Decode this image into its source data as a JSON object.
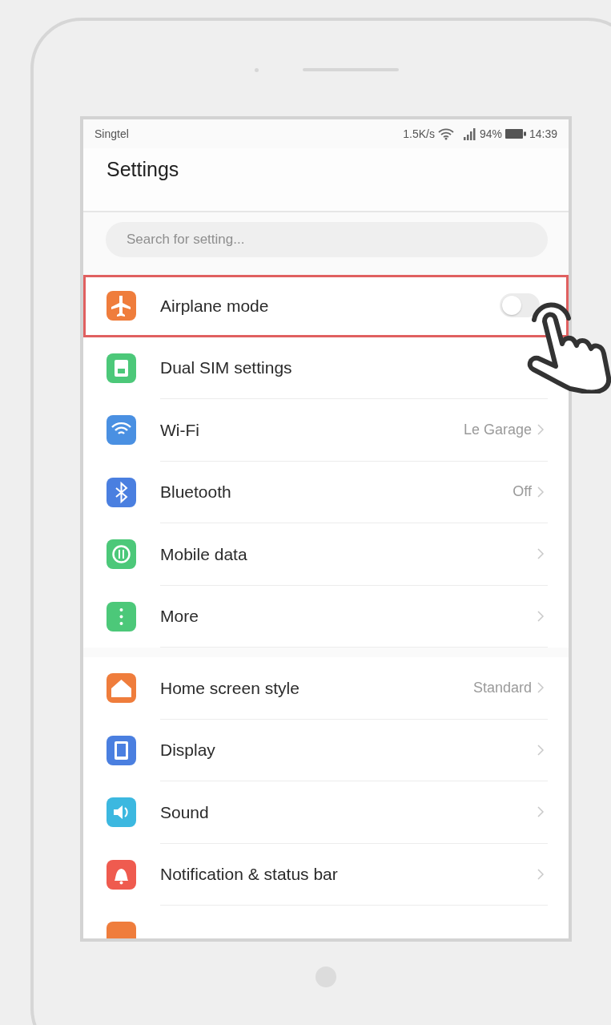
{
  "status_bar": {
    "carrier": "Singtel",
    "speed": "1.5K/s",
    "battery": "94%",
    "time": "14:39"
  },
  "title": "Settings",
  "search": {
    "placeholder": "Search for setting..."
  },
  "groups": [
    {
      "items": [
        {
          "label": "Airplane mode",
          "kind": "toggle",
          "on": false,
          "highlighted": true,
          "color": "#ef7d3c"
        },
        {
          "label": "Dual SIM settings",
          "kind": "covered",
          "highlighted": false,
          "color": "#4cc879"
        },
        {
          "label": "Wi-Fi",
          "kind": "link",
          "value": "Le Garage",
          "highlighted": false,
          "color": "#4a90e2"
        },
        {
          "label": "Bluetooth",
          "kind": "link",
          "value": "Off",
          "highlighted": false,
          "color": "#4a7fe0"
        },
        {
          "label": "Mobile data",
          "kind": "link",
          "highlighted": false,
          "color": "#4cc879"
        },
        {
          "label": "More",
          "kind": "link",
          "highlighted": false,
          "color": "#4cc879"
        }
      ]
    },
    {
      "items": [
        {
          "label": "Home screen style",
          "kind": "link",
          "value": "Standard",
          "highlighted": false,
          "color": "#ef7d3c"
        },
        {
          "label": "Display",
          "kind": "link",
          "highlighted": false,
          "color": "#4a7fe0"
        },
        {
          "label": "Sound",
          "kind": "link",
          "highlighted": false,
          "color": "#3cb8e0"
        },
        {
          "label": "Notification & status bar",
          "kind": "link",
          "highlighted": false,
          "color": "#ef5b4f"
        },
        {
          "kind": "partial",
          "color": "#ef7d3c"
        }
      ]
    }
  ]
}
